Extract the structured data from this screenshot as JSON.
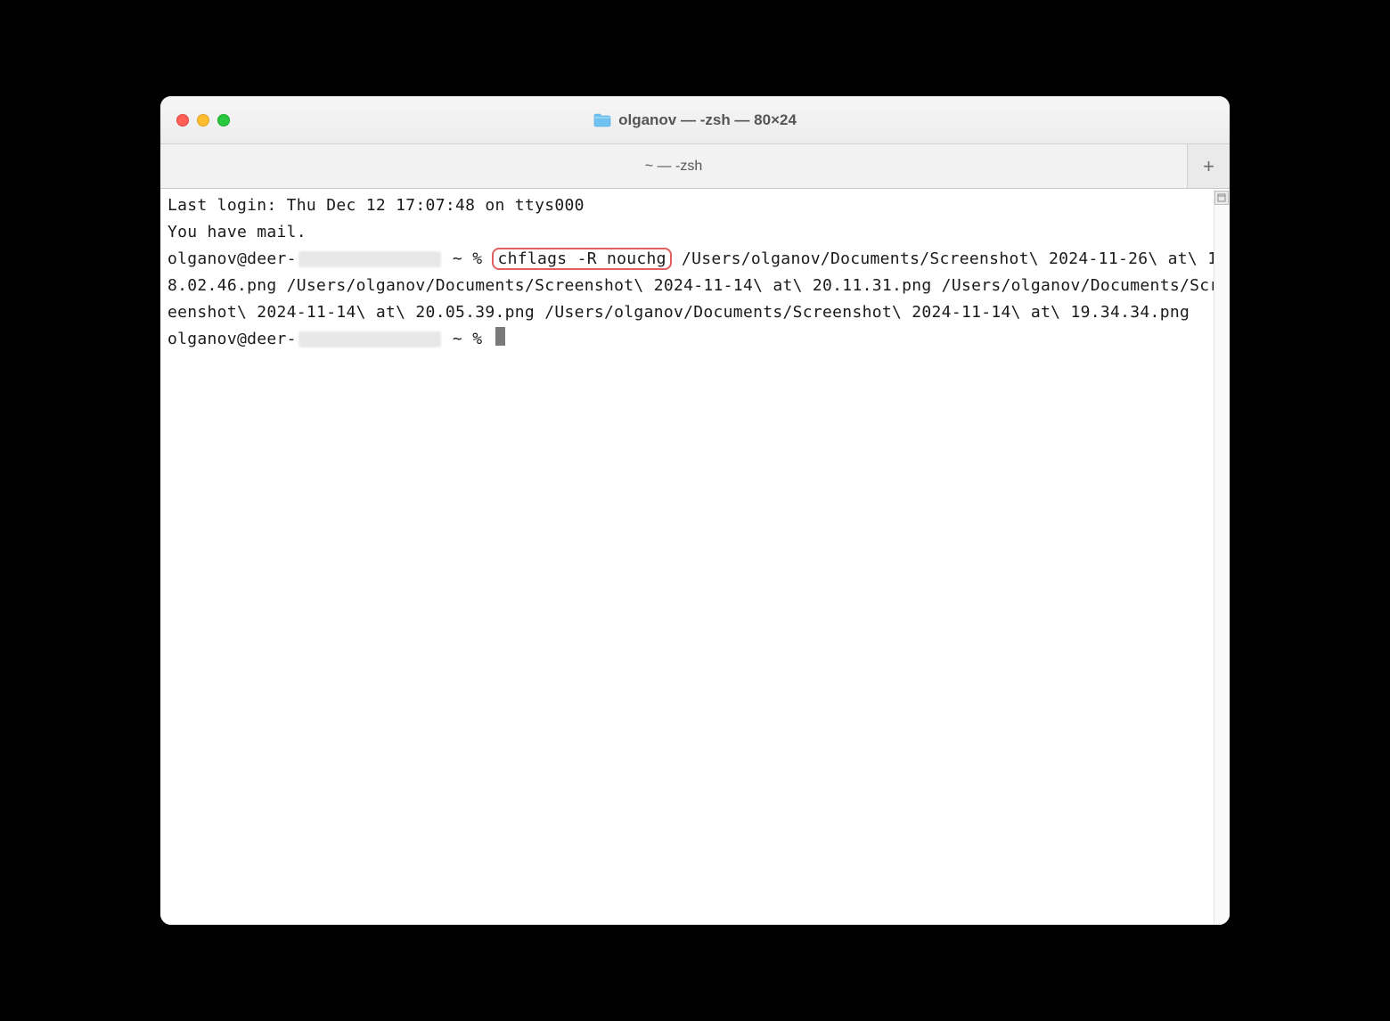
{
  "window": {
    "title": "olganov — -zsh — 80×24"
  },
  "tabbar": {
    "tab_label": "~ — -zsh",
    "new_tab_glyph": "+"
  },
  "terminal": {
    "last_login": "Last login: Thu Dec 12 17:07:48 on ttys000",
    "mail_notice": "You have mail.",
    "prompt_prefix": "olganov@deer-",
    "prompt_suffix": " ~ % ",
    "highlighted_command": "chflags -R nouchg",
    "command_paths": " /Users/olganov/Documents/Screenshot\\ 2024-11-26\\ at\\ 18.02.46.png /Users/olganov/Documents/Screenshot\\ 2024-11-14\\ at\\ 20.11.31.png /Users/olganov/Documents/Screenshot\\ 2024-11-14\\ at\\ 20.05.39.png /Users/olganov/Documents/Screenshot\\ 2024-11-14\\ at\\ 19.34.34.png",
    "prompt2_prefix": "olganov@deer-",
    "prompt2_suffix": " ~ % "
  }
}
